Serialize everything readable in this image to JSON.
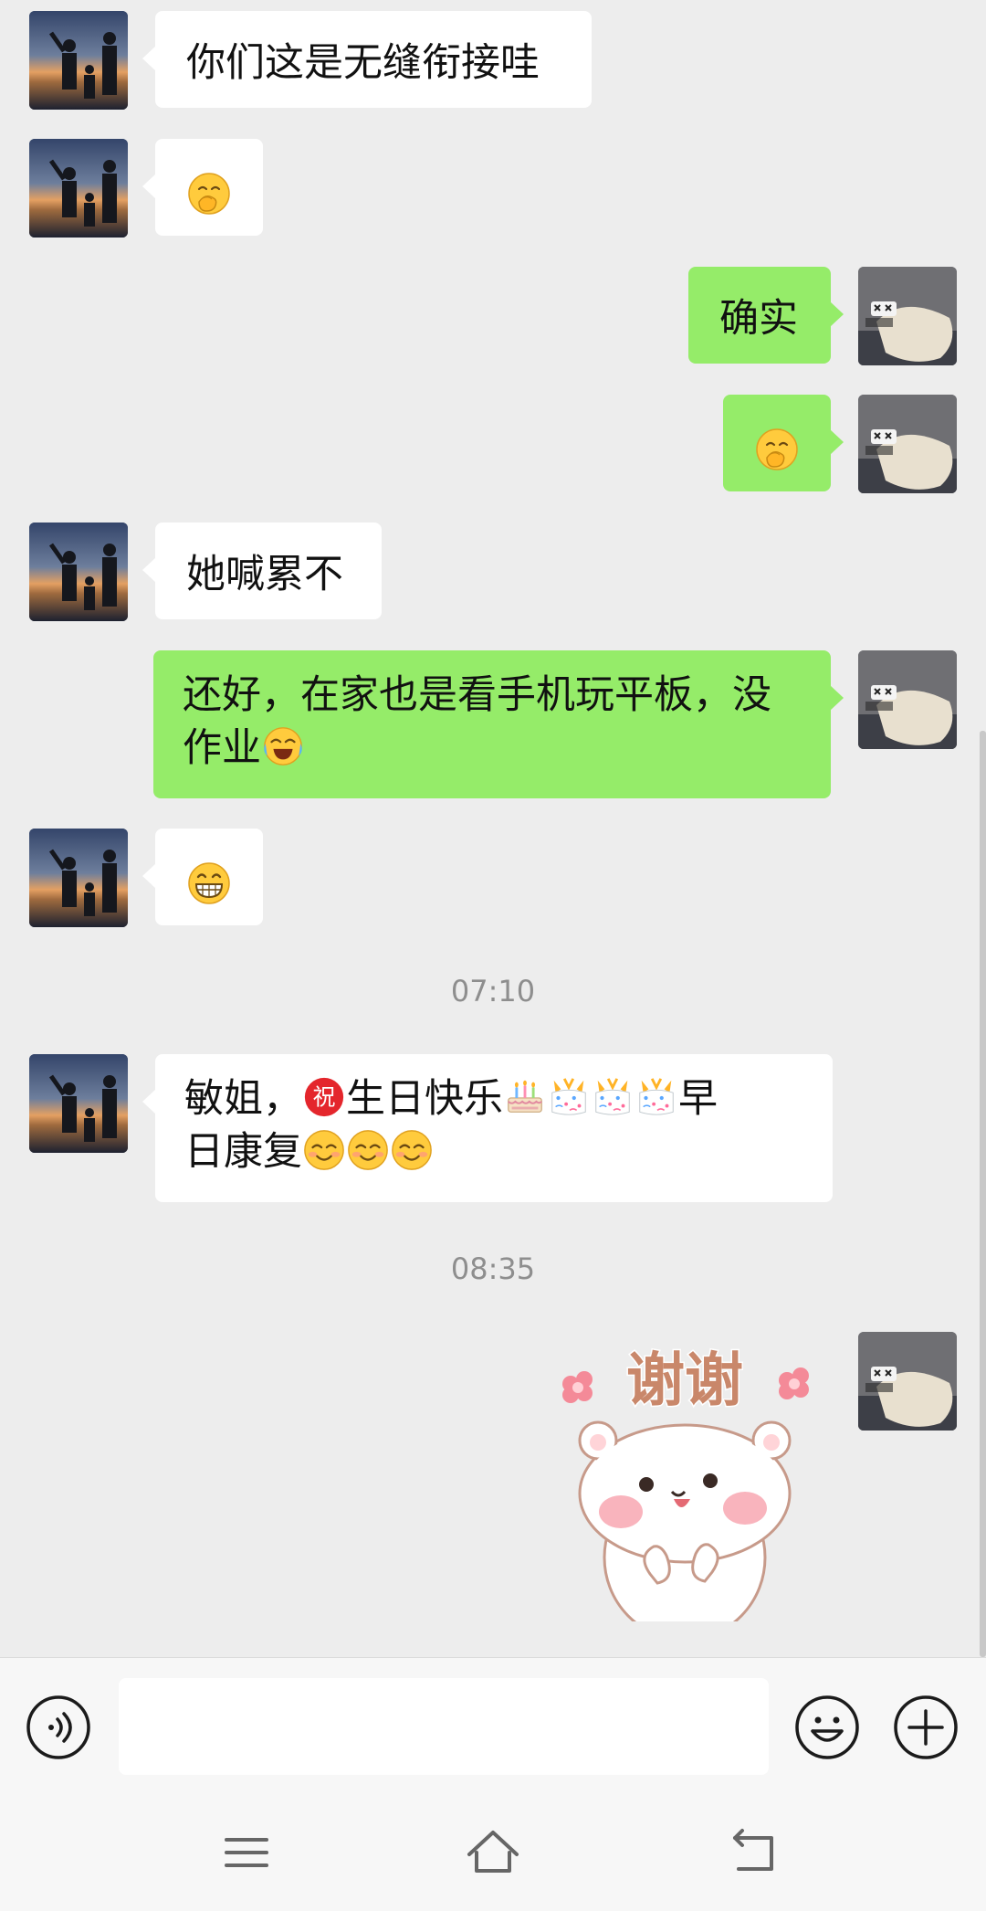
{
  "messages": [
    {
      "id": "m1",
      "side": "in",
      "text": "你们这是无缝衔接哇"
    },
    {
      "id": "m2",
      "side": "in",
      "emoji": "face-with-hand-over-mouth"
    },
    {
      "id": "m3",
      "side": "out",
      "text": "确实"
    },
    {
      "id": "m4",
      "side": "out",
      "emoji": "face-with-hand-over-mouth"
    },
    {
      "id": "m5",
      "side": "in",
      "text": "她喊累不"
    },
    {
      "id": "m6",
      "side": "out",
      "line1": "还好，在家也是看手机玩平板，没",
      "line2": "作业"
    },
    {
      "id": "m7",
      "side": "in",
      "emoji": "grinning-face-with-teeth"
    },
    {
      "id": "m8",
      "side": "in",
      "line1_a": "敏姐，",
      "line1_b": "生日快乐",
      "line1_c": "早",
      "line2": "日康复"
    },
    {
      "id": "m9",
      "side": "out",
      "sticker": "bear-thanks-sticker",
      "sticker_text": "谢谢"
    }
  ],
  "timestamps": [
    "07:10",
    "08:35"
  ],
  "input": {
    "value": "",
    "placeholder": ""
  },
  "colors": {
    "background": "#ededed",
    "bubble_in": "#ffffff",
    "bubble_out": "#95ec69",
    "timestamp": "#8e8e8e"
  },
  "icons": {
    "voice": "voice-icon",
    "emoji": "emoji-icon",
    "add": "plus-icon",
    "nav_menu": "menu-icon",
    "nav_home": "home-icon",
    "nav_back": "back-icon"
  }
}
